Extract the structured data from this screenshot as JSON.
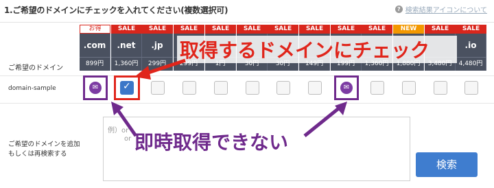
{
  "heading": "1.ご希望のドメインにチェックを入れてください(複数選択可)",
  "help_link": "検索結果アイコンについて",
  "row_labels": {
    "domain_row": "ご希望のドメイン",
    "sample_row": "domain-sample",
    "add_row_line1": "ご希望のドメインを追加",
    "add_row_line2": "もしくは再検索する"
  },
  "tld_columns": [
    {
      "badge": "お得",
      "badge_type": "otoku",
      "tld": ".com",
      "price": "899円",
      "state": "unavailable"
    },
    {
      "badge": "SALE",
      "badge_type": "sale",
      "tld": ".net",
      "price": "1,360円",
      "state": "checked"
    },
    {
      "badge": "SALE",
      "badge_type": "sale",
      "tld": ".jp",
      "price": "299円",
      "state": "unchecked"
    },
    {
      "badge": "SALE",
      "badge_type": "sale",
      "tld": "",
      "price": "299円",
      "state": "unchecked"
    },
    {
      "badge": "SALE",
      "badge_type": "sale",
      "tld": "",
      "price": "1円",
      "state": "unchecked"
    },
    {
      "badge": "SALE",
      "badge_type": "sale",
      "tld": "",
      "price": "30円",
      "state": "unchecked"
    },
    {
      "badge": "SALE",
      "badge_type": "sale",
      "tld": "",
      "price": "30円",
      "state": "unchecked"
    },
    {
      "badge": "SALE",
      "badge_type": "sale",
      "tld": "",
      "price": "149円",
      "state": "unchecked"
    },
    {
      "badge": "SALE",
      "badge_type": "sale",
      "tld": "",
      "price": "199円",
      "state": "unavailable"
    },
    {
      "badge": "SALE",
      "badge_type": "sale",
      "tld": "",
      "price": "1,360円",
      "state": "unchecked"
    },
    {
      "badge": "NEW",
      "badge_type": "new",
      "tld": "",
      "price": "1,880円",
      "state": "unchecked"
    },
    {
      "badge": "SALE",
      "badge_type": "sale",
      "tld": "",
      "price": "3,480円",
      "state": "unchecked"
    },
    {
      "badge": "SALE",
      "badge_type": "sale",
      "tld": ".io",
      "price": "4,480円",
      "state": "unchecked"
    }
  ],
  "textarea_placeholder_line1": "例）or",
  "textarea_placeholder_line2": "or",
  "search_button": "検索",
  "annotation_red": "取得するドメインにチェック",
  "annotation_purple": "即時取得できない",
  "colors": {
    "annotation_red": "#e0251b",
    "annotation_purple": "#6f2a8c",
    "header_bg": "#4a5160",
    "sale": "#d9261c",
    "new": "#f39800",
    "button": "#3f7dcf"
  }
}
